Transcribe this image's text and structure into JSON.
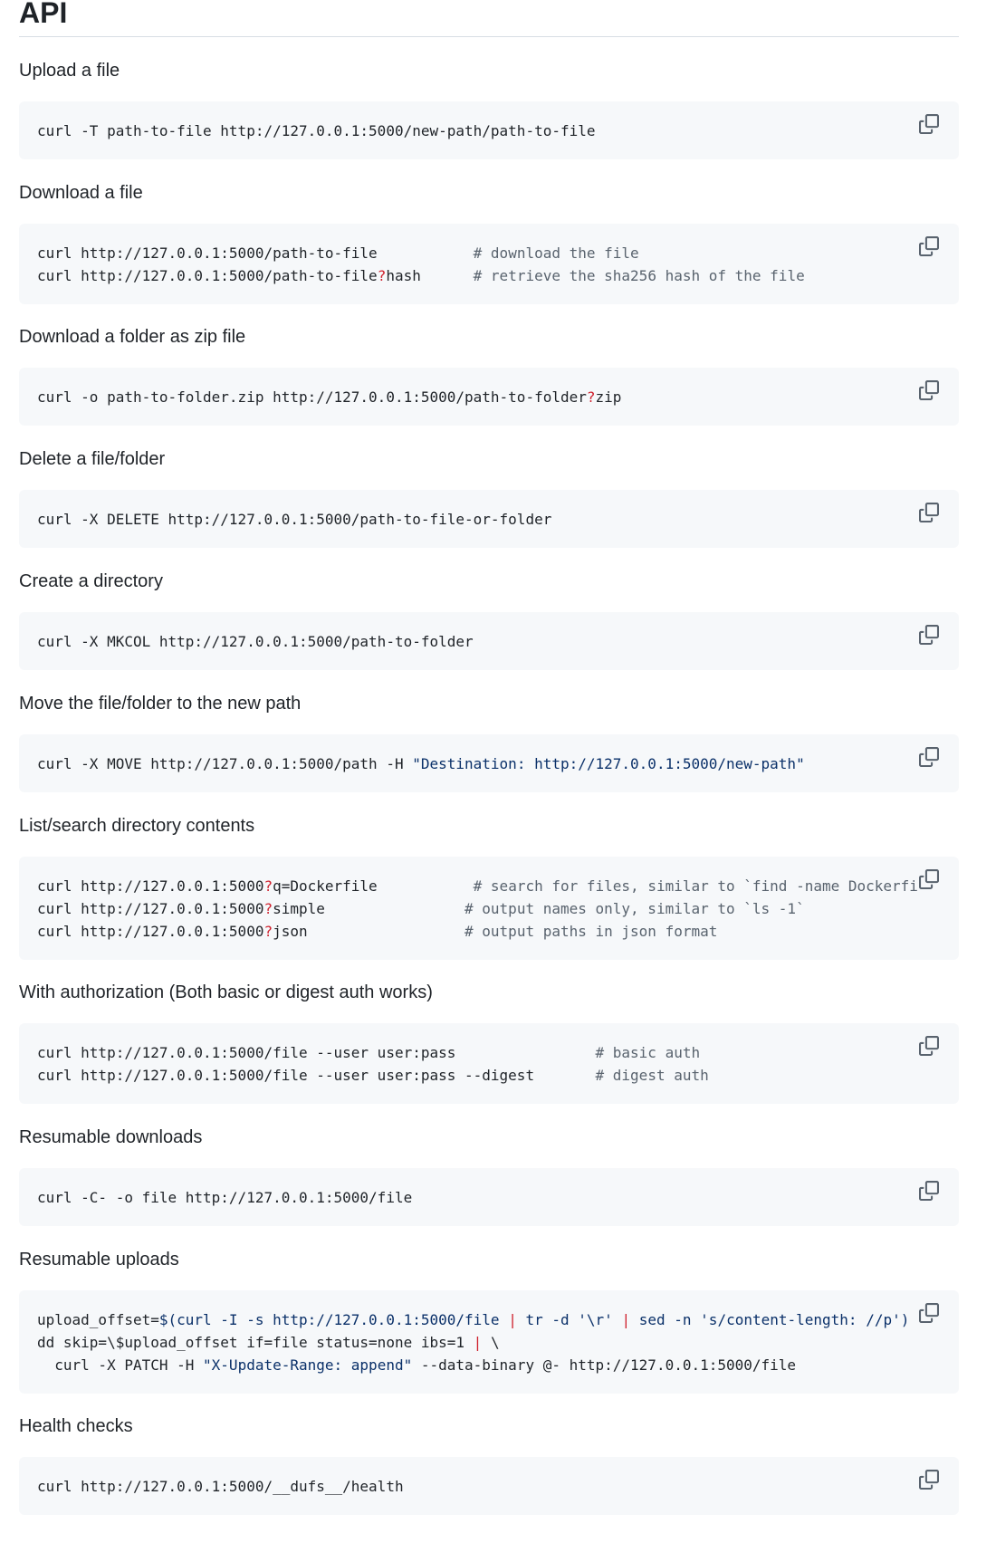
{
  "page": {
    "title": "API"
  },
  "sections": [
    {
      "label": "Upload a file",
      "code": [
        {
          "cmd": "curl -T path-to-file http://127.0.0.1:5000/new-path/path-to-file"
        }
      ]
    },
    {
      "label": "Download a file",
      "code": [
        {
          "cmd": "curl http://127.0.0.1:5000/path-to-file",
          "comment": "# download the file"
        },
        {
          "cmd_a": "curl http://127.0.0.1:5000/path-to-file",
          "q": "?",
          "cmd_b": "hash",
          "comment": "# retrieve the sha256 hash of the file"
        }
      ]
    },
    {
      "label": "Download a folder as zip file",
      "code": [
        {
          "cmd_a": "curl -o path-to-folder.zip http://127.0.0.1:5000/path-to-folder",
          "q": "?",
          "cmd_b": "zip"
        }
      ]
    },
    {
      "label": "Delete a file/folder",
      "code": [
        {
          "cmd": "curl -X DELETE http://127.0.0.1:5000/path-to-file-or-folder"
        }
      ]
    },
    {
      "label": "Create a directory",
      "code": [
        {
          "cmd": "curl -X MKCOL http://127.0.0.1:5000/path-to-folder"
        }
      ]
    },
    {
      "label": "Move the file/folder to the new path",
      "code": [
        {
          "cmd": "curl -X MOVE http://127.0.0.1:5000/path -H ",
          "str": "\"Destination: http://127.0.0.1:5000/new-path\""
        }
      ]
    },
    {
      "label": "List/search directory contents",
      "code": [
        {
          "cmd_a": "curl http://127.0.0.1:5000",
          "q": "?",
          "cmd_b": "q=Dockerfile",
          "comment": "# search for files, similar to `find -name Dockerfile`"
        },
        {
          "cmd_a": "curl http://127.0.0.1:5000",
          "q": "?",
          "cmd_b": "simple",
          "comment": "# output names only, similar to `ls -1`"
        },
        {
          "cmd_a": "curl http://127.0.0.1:5000",
          "q": "?",
          "cmd_b": "json",
          "comment": "# output paths in json format"
        }
      ]
    },
    {
      "label": "With authorization (Both basic or digest auth works)",
      "code": [
        {
          "cmd": "curl http://127.0.0.1:5000/file --user user:pass",
          "comment": "# basic auth"
        },
        {
          "cmd": "curl http://127.0.0.1:5000/file --user user:pass --digest",
          "comment": "# digest auth"
        }
      ]
    },
    {
      "label": "Resumable downloads",
      "code": [
        {
          "cmd": "curl -C- -o file http://127.0.0.1:5000/file"
        }
      ]
    },
    {
      "label": "Resumable uploads",
      "code": [
        {
          "p1": "upload_offset=",
          "s1": "$(curl -I -s http://127.0.0.1:5000/file",
          "o1": "|",
          "s2": "tr -d",
          "s3": "'\\r'",
          "o2": "|",
          "s4": "sed -n",
          "s5": "'s/content-length: //p')"
        },
        {
          "p1": "dd skip=\\$upload_offset if=file status=none ibs=1",
          "o1": "|",
          "p2": "\\"
        },
        {
          "p1": "  curl -X PATCH -H ",
          "s1": "\"X-Update-Range: append\"",
          "p2": " --data-binary @- http://127.0.0.1:5000/file"
        }
      ]
    },
    {
      "label": "Health checks",
      "code": [
        {
          "cmd": "curl http://127.0.0.1:5000/__dufs__/health"
        }
      ]
    }
  ],
  "copy_icon": "copy-icon"
}
